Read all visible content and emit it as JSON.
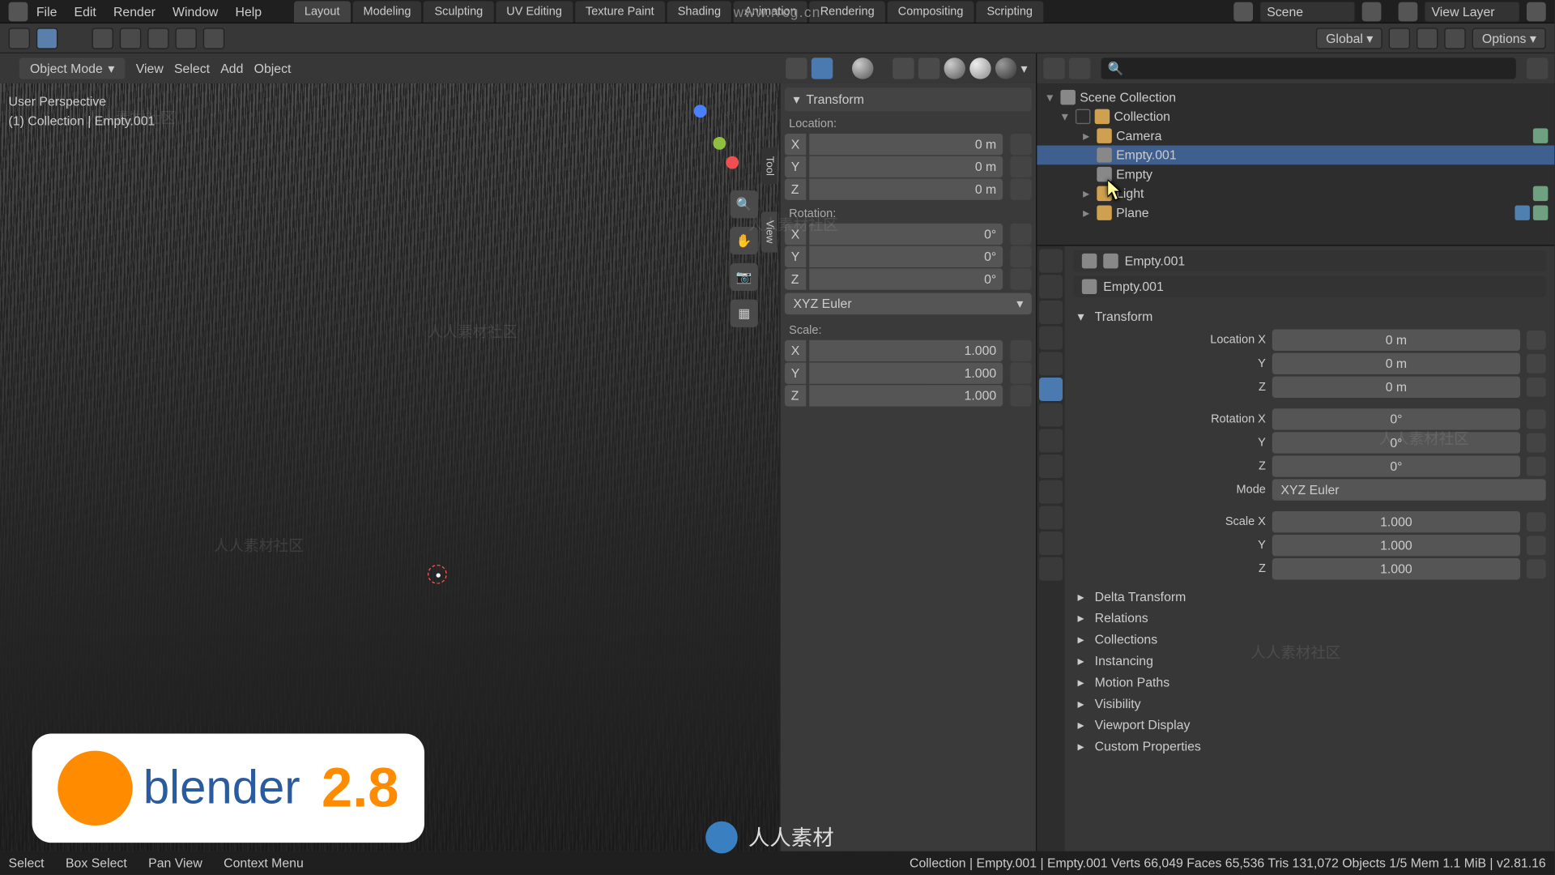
{
  "watermark_url": "www.rrcg.cn",
  "watermark_text": "人人素材社区",
  "overlay_brand": "人人素材",
  "topbar": {
    "menu": [
      "File",
      "Edit",
      "Render",
      "Window",
      "Help"
    ],
    "tabs": [
      "Layout",
      "Modeling",
      "Sculpting",
      "UV Editing",
      "Texture Paint",
      "Shading",
      "Animation",
      "Rendering",
      "Compositing",
      "Scripting"
    ],
    "active_tab": "Layout",
    "scene_label": "Scene",
    "viewlayer_label": "View Layer"
  },
  "toolhdr": {
    "orientation": "Global",
    "options": "Options"
  },
  "vphdr": {
    "mode": "Object Mode",
    "menus": [
      "View",
      "Select",
      "Add",
      "Object"
    ]
  },
  "vpinfo": {
    "line1": "User Perspective",
    "line2": "(1) Collection | Empty.001"
  },
  "sidetabs": {
    "tool": "Tool",
    "view": "View"
  },
  "npanel": {
    "title": "Transform",
    "location_label": "Location:",
    "rotation_label": "Rotation:",
    "scale_label": "Scale:",
    "rot_mode": "XYZ Euler",
    "loc": {
      "x": "0 m",
      "y": "0 m",
      "z": "0 m"
    },
    "rot": {
      "x": "0°",
      "y": "0°",
      "z": "0°"
    },
    "scl": {
      "x": "1.000",
      "y": "1.000",
      "z": "1.000"
    },
    "ax": {
      "x": "X",
      "y": "Y",
      "z": "Z"
    }
  },
  "outliner": {
    "root": "Scene Collection",
    "collection": "Collection",
    "items": [
      "Camera",
      "Empty.001",
      "Empty",
      "Light",
      "Plane"
    ],
    "selected": "Empty.001"
  },
  "props": {
    "crumb1": "Empty.001",
    "crumb2": "Empty.001",
    "transform_label": "Transform",
    "loc_x": "Location X",
    "val_loc_x": "0 m",
    "loc_y": "Y",
    "val_loc_y": "0 m",
    "loc_z": "Z",
    "val_loc_z": "0 m",
    "rot_x": "Rotation X",
    "val_rot_x": "0°",
    "rot_y": "Y",
    "val_rot_y": "0°",
    "rot_z": "Z",
    "val_rot_z": "0°",
    "mode_label": "Mode",
    "mode_val": "XYZ Euler",
    "scl_x": "Scale X",
    "val_scl_x": "1.000",
    "scl_y": "Y",
    "val_scl_y": "1.000",
    "scl_z": "Z",
    "val_scl_z": "1.000",
    "sections": [
      "Delta Transform",
      "Relations",
      "Collections",
      "Instancing",
      "Motion Paths",
      "Visibility",
      "Viewport Display",
      "Custom Properties"
    ]
  },
  "status": {
    "select": "Select",
    "box": "Box Select",
    "pan": "Pan View",
    "context": "Context Menu",
    "info": "Collection | Empty.001 | Empty.001   Verts 66,049   Faces 65,536   Tris 131,072   Objects 1/5   Mem 1.1 MiB | v2.81.16"
  },
  "logo": {
    "name": "blender",
    "version": "2.8"
  }
}
